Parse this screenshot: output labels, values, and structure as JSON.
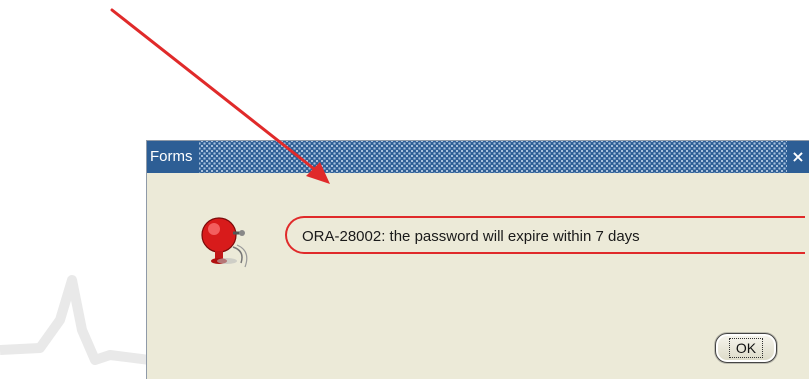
{
  "dialog": {
    "title": "Forms",
    "close_glyph": "×",
    "message": "ORA-28002: the password will expire within 7 days",
    "ok_label": "OK",
    "icon": "alarm-bell-icon"
  },
  "annotations": {
    "arrow_color": "#e02a2a",
    "highlight_color": "#e02a2a"
  },
  "colors": {
    "titlebar": "#2d5e95",
    "dialog_background": "#ecead8"
  }
}
